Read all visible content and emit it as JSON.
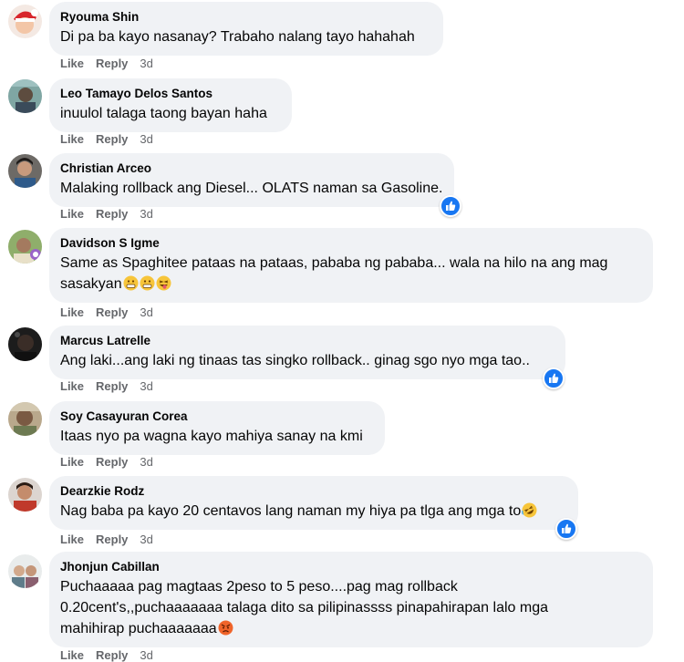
{
  "comments": [
    {
      "author": "Ryouma Shin",
      "lines": [
        "Di pa ba kayo nasanay? Trabaho nalang tayo hahahah"
      ],
      "like": "Like",
      "reply": "Reply",
      "time": "3d"
    },
    {
      "author": "Leo Tamayo Delos Santos",
      "lines": [
        "inuulol talaga taong bayan haha"
      ],
      "like": "Like",
      "reply": "Reply",
      "time": "3d"
    },
    {
      "author": "Christian Arceo",
      "lines": [
        "Malaking rollback ang Diesel... OLATS naman sa Gasoline."
      ],
      "like": "Like",
      "reply": "Reply",
      "time": "3d",
      "reaction": "like"
    },
    {
      "author": "Davidson S Igme",
      "lines": [
        "Same as Spaghitee pataas na pataas, pababa ng pababa... wala na hilo na ang mag",
        "sasakyan"
      ],
      "like": "Like",
      "reply": "Reply",
      "time": "3d",
      "emojis": [
        "grimace-emoji",
        "grimace-emoji",
        "tongue-out-emoji"
      ]
    },
    {
      "author": "Marcus Latrelle",
      "lines": [
        "Ang laki...ang laki ng tinaas tas singko rollback.. ginag sgo nyo mga tao.."
      ],
      "like": "Like",
      "reply": "Reply",
      "time": "3d",
      "reaction": "like"
    },
    {
      "author": "Soy Casayuran Corea",
      "lines": [
        "Itaas nyo pa wagna kayo mahiya sanay na kmi"
      ],
      "like": "Like",
      "reply": "Reply",
      "time": "3d"
    },
    {
      "author": "Dearzkie Rodz",
      "lines": [
        "Nag baba pa kayo 20 centavos lang naman my hiya pa tlga ang mga to"
      ],
      "like": "Like",
      "reply": "Reply",
      "time": "3d",
      "reaction": "like",
      "emojis": [
        "rofl-emoji"
      ]
    },
    {
      "author": "Jhonjun Cabillan",
      "lines": [
        "Puchaaaaa pag magtaas 2peso to 5 peso....pag mag rollback",
        "0.20cent's,,puchaaaaaaa talaga dito sa pilipinassss pinapahirapan lalo mga",
        "mahihirap puchaaaaaaa"
      ],
      "like": "Like",
      "reply": "Reply",
      "time": "3d",
      "emojis": [
        "angry-face-emoji"
      ]
    }
  ],
  "colors": {
    "bubble": "#f0f2f5",
    "meta": "#65676b",
    "like_reaction": "#1877f2"
  }
}
